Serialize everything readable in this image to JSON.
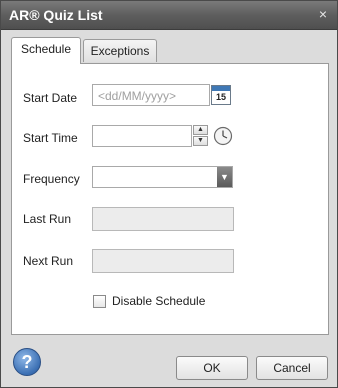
{
  "window": {
    "title": "AR® Quiz List",
    "close_symbol": "×"
  },
  "tabs": [
    {
      "label": "Schedule",
      "active": true
    },
    {
      "label": "Exceptions",
      "active": false
    }
  ],
  "form": {
    "start_date": {
      "label": "Start Date",
      "value": "",
      "placeholder": "<dd/MM/yyyy>",
      "icon": "calendar-icon",
      "calendar_day": "15"
    },
    "start_time": {
      "label": "Start Time",
      "value": "",
      "icon": "clock-icon"
    },
    "frequency": {
      "label": "Frequency",
      "value": ""
    },
    "last_run": {
      "label": "Last Run",
      "value": "",
      "readonly": true
    },
    "next_run": {
      "label": "Next Run",
      "value": "",
      "readonly": true
    },
    "disable_schedule": {
      "label": "Disable Schedule",
      "checked": false
    }
  },
  "footer": {
    "help_symbol": "?",
    "ok_label": "OK",
    "cancel_label": "Cancel"
  },
  "colors": {
    "titlebar": "#5e5e5e",
    "accent": "#3f78b5",
    "dialog_bg": "#dcdcdc"
  }
}
